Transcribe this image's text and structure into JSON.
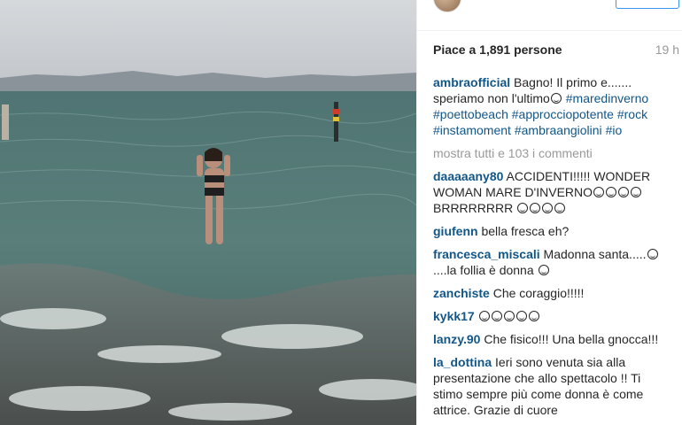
{
  "post": {
    "likes_text": "Piace a 1,891 persone",
    "time": "19 h"
  },
  "caption": {
    "user": "ambraofficial",
    "text": "Bagno! Il primo e....... speriamo non l'ultimo",
    "emoji": "smiling-face",
    "hashtags": [
      "#maredinverno",
      "#poettobeach",
      "#approcciopotente",
      "#rock",
      "#instamoment",
      "#ambraangiolini",
      "#io"
    ]
  },
  "show_all": "mostra tutti e 103 i commenti",
  "comments": [
    {
      "user": "daaaaany80",
      "text": "ACCIDENTI!!!!! WONDER WOMAN MARE D'INVERNO",
      "text2": "BRRRRRRRR"
    },
    {
      "user": "giufenn",
      "text": "bella fresca eh?"
    },
    {
      "user": "francesca_miscali",
      "text": "Madonna santa.....",
      "text2": "....la follia è donna"
    },
    {
      "user": "zanchiste",
      "text": "Che coraggio!!!!!"
    },
    {
      "user": "kykk17",
      "text": ""
    },
    {
      "user": "lanzy.90",
      "text": "Che fisico!!! Una bella gnocca!!!"
    },
    {
      "user": "la_dottina",
      "text": "Ieri sono venuta sia alla presentazione che allo spettacolo !! Ti stimo sempre più come donna è come attrice. Grazie di cuore"
    }
  ],
  "colors": {
    "username": "#125688",
    "text": "#262626",
    "muted": "#999999",
    "accent": "#3897f0"
  }
}
